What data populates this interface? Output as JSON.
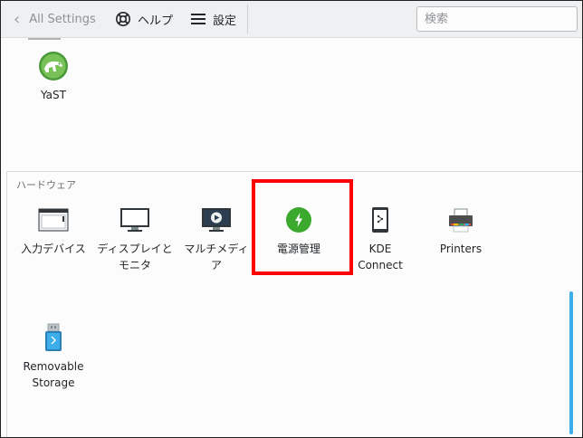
{
  "toolbar": {
    "back_label": "All Settings",
    "help_label": "ヘルプ",
    "settings_label": "設定",
    "search_placeholder": "検索"
  },
  "prev_section": {
    "items": [
      {
        "label": "YaST",
        "icon": "yast-chameleon-icon"
      }
    ]
  },
  "hardware": {
    "title": "ハードウェア",
    "items": [
      {
        "label_lines": [
          "入力デバイス"
        ],
        "icon": "input-devices-icon"
      },
      {
        "label_lines": [
          "ディスプレイと",
          "モニタ"
        ],
        "icon": "display-monitor-icon"
      },
      {
        "label_lines": [
          "マルチメディ",
          "ア"
        ],
        "icon": "multimedia-icon"
      },
      {
        "label_lines": [
          "電源管理"
        ],
        "icon": "power-management-icon",
        "highlighted": true
      },
      {
        "label_lines": [
          "KDE",
          "Connect"
        ],
        "icon": "kde-connect-icon"
      },
      {
        "label_lines": [
          "Printers"
        ],
        "icon": "printer-icon"
      },
      {
        "label_lines": [
          "Removable",
          "Storage"
        ],
        "icon": "removable-storage-icon"
      }
    ]
  },
  "colors": {
    "accent": "#3daee9",
    "highlight": "#ff0000",
    "power_green": "#3aa92e"
  }
}
